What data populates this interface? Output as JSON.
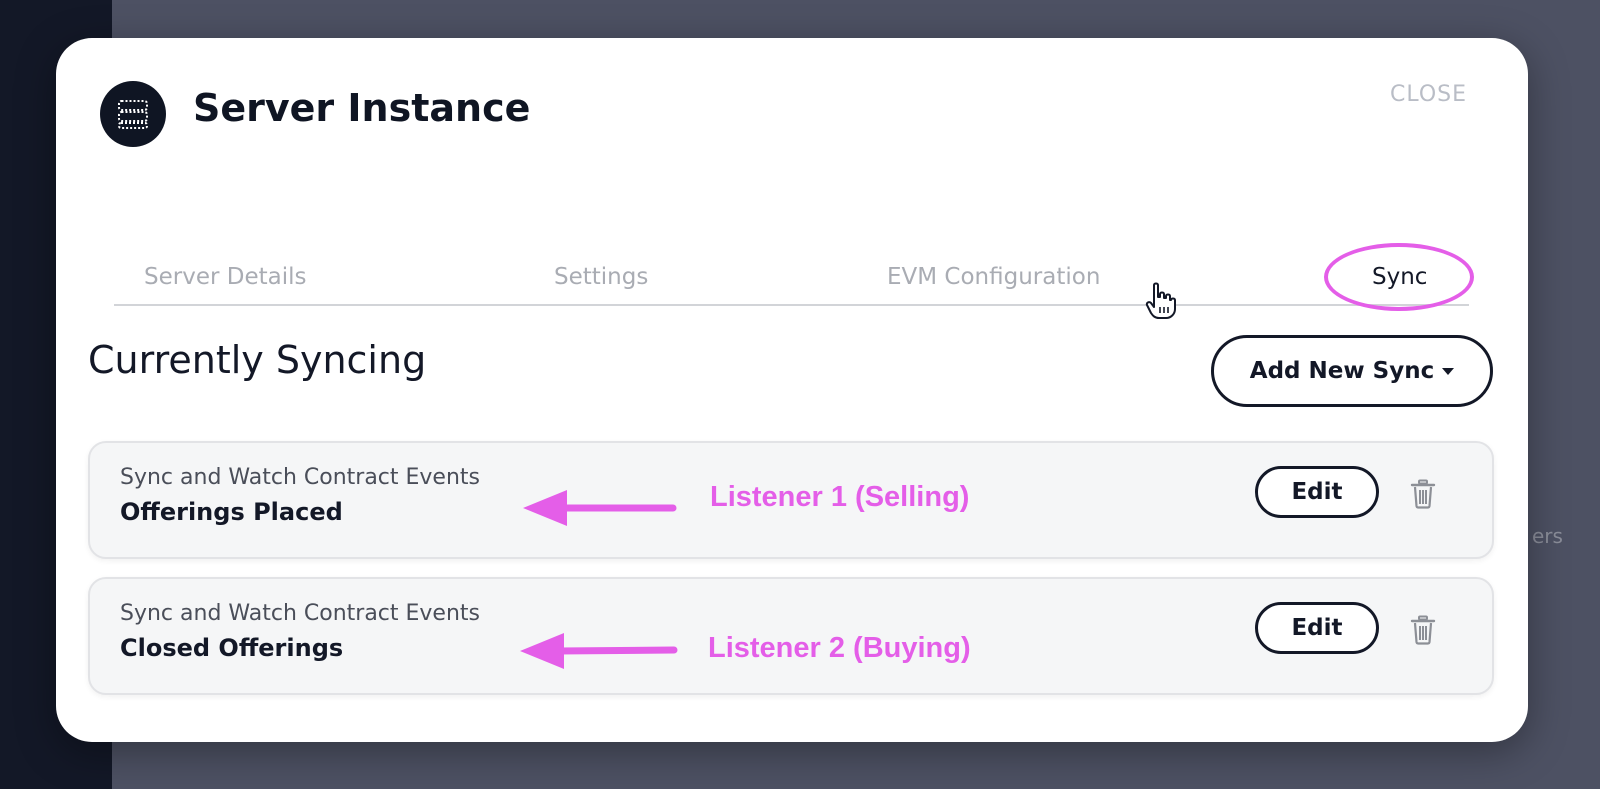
{
  "background": {
    "partial_text": "ers"
  },
  "modal": {
    "title": "Server Instance",
    "close_label": "CLOSE",
    "header_icon": "server-icon"
  },
  "tabs": [
    {
      "label": "Server Details",
      "active": false
    },
    {
      "label": "Settings",
      "active": false
    },
    {
      "label": "EVM Configuration",
      "active": false
    },
    {
      "label": "Sync",
      "active": true
    }
  ],
  "section": {
    "title": "Currently Syncing",
    "add_button_label": "Add New Sync"
  },
  "syncs": [
    {
      "subtitle": "Sync and Watch Contract Events",
      "name": "Offerings Placed",
      "edit_label": "Edit"
    },
    {
      "subtitle": "Sync and Watch Contract Events",
      "name": "Closed Offerings",
      "edit_label": "Edit"
    }
  ],
  "annotations": [
    {
      "text": "Listener 1 (Selling)"
    },
    {
      "text": "Listener 2 (Buying)"
    }
  ],
  "colors": {
    "accent": "#e45ee8",
    "dark": "#131827",
    "modal_bg": "#ffffff",
    "backdrop": "#4d5163"
  }
}
